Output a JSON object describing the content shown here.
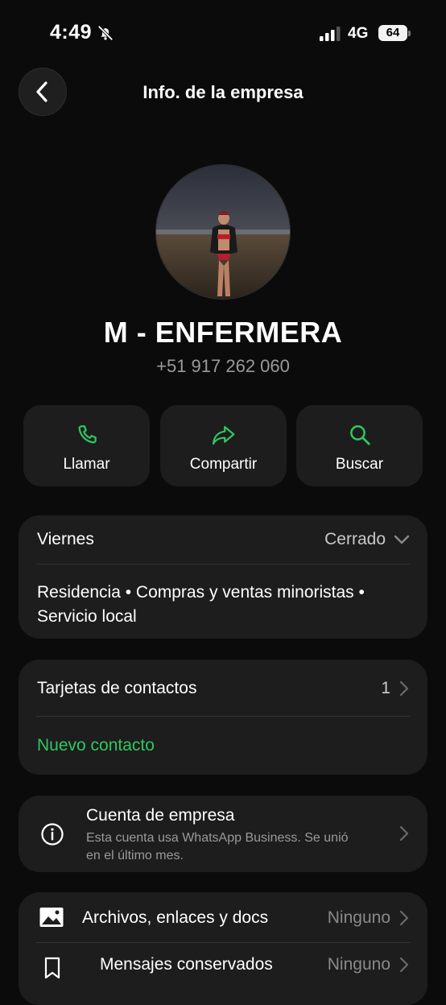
{
  "status_bar": {
    "time": "4:49",
    "network": "4G",
    "battery": "64"
  },
  "header": {
    "title": "Info. de la empresa"
  },
  "profile": {
    "name": "M - ENFERMERA",
    "phone": "+51 917 262 060"
  },
  "actions": [
    {
      "label": "Llamar",
      "icon": "phone-icon"
    },
    {
      "label": "Compartir",
      "icon": "share-icon"
    },
    {
      "label": "Buscar",
      "icon": "search-icon"
    }
  ],
  "hours": {
    "day": "Viernes",
    "status": "Cerrado"
  },
  "categories": {
    "line1": "Residencia • Compras y ventas minoristas •",
    "line2": "Servicio local"
  },
  "contact_cards": {
    "label": "Tarjetas de contactos",
    "count": "1",
    "new_contact": "Nuevo contacto"
  },
  "business_account": {
    "title": "Cuenta de empresa",
    "desc_line1": "Esta cuenta usa WhatsApp Business. Se unió",
    "desc_line2": "en el último mes."
  },
  "media": {
    "label": "Archivos, enlaces y docs",
    "value": "Ninguno"
  },
  "saved": {
    "label": "Mensajes conservados",
    "value": "Ninguno"
  },
  "colors": {
    "accent": "#2fc760",
    "background": "#0b0b0b",
    "card": "#1d1d1d"
  }
}
